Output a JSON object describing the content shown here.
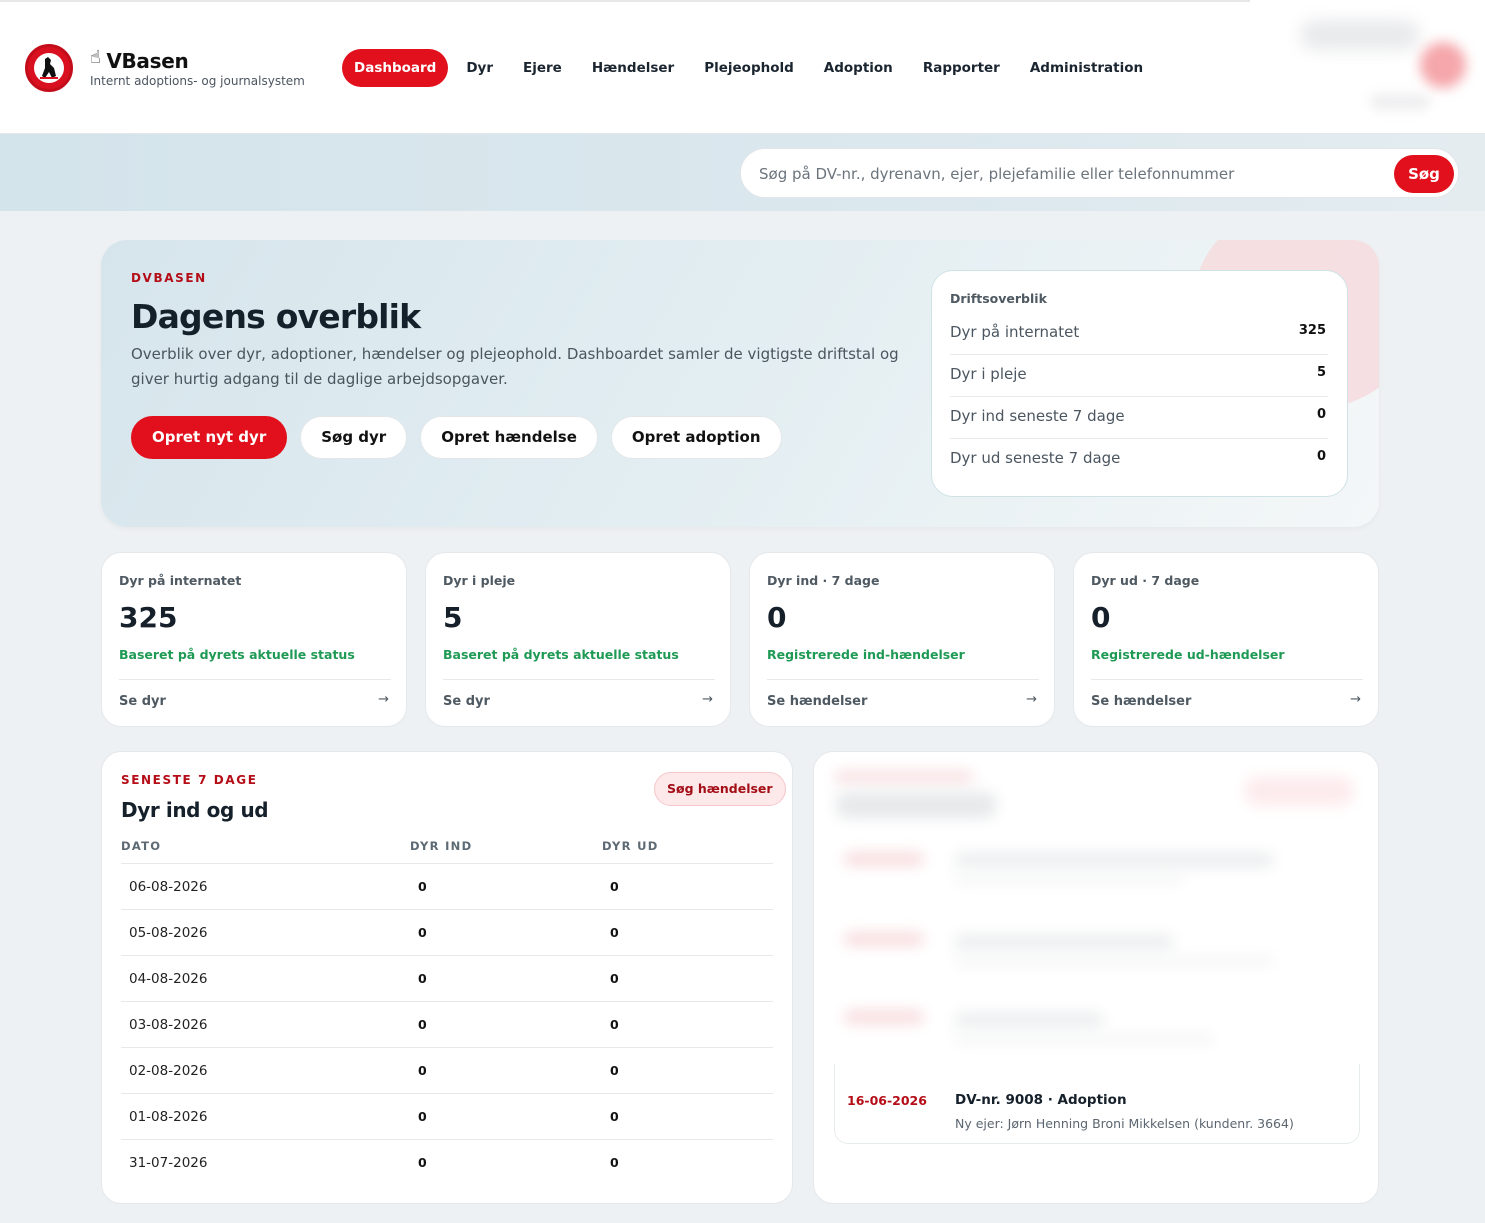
{
  "header": {
    "brand_name": "VBasen",
    "brand_cursor": "☝",
    "brand_sub": "Internt adoptions- og journalsystem",
    "nav": [
      {
        "label": "Dashboard",
        "active": true
      },
      {
        "label": "Dyr"
      },
      {
        "label": "Ejere"
      },
      {
        "label": "Hændelser"
      },
      {
        "label": "Plejeophold"
      },
      {
        "label": "Adoption"
      },
      {
        "label": "Rapporter"
      },
      {
        "label": "Administration"
      }
    ]
  },
  "search": {
    "placeholder": "Søg på DV-nr., dyrenavn, ejer, plejefamilie eller telefonnummer",
    "button_label": "Søg"
  },
  "hero": {
    "eyebrow": "DVBASEN",
    "title": "Dagens overblik",
    "description": "Overblik over dyr, adoptioner, hændelser og plejeophold. Dashboardet samler de vigtigste driftstal og giver hurtig adgang til de daglige arbejdsopgaver.",
    "buttons": [
      "Opret nyt dyr",
      "Søg dyr",
      "Opret hændelse",
      "Opret adoption"
    ]
  },
  "drift": {
    "title": "Driftsoverblik",
    "rows": [
      {
        "label": "Dyr på internatet",
        "value": "325"
      },
      {
        "label": "Dyr i pleje",
        "value": "5"
      },
      {
        "label": "Dyr ind seneste 7 dage",
        "value": "0"
      },
      {
        "label": "Dyr ud seneste 7 dage",
        "value": "0"
      }
    ]
  },
  "stats": [
    {
      "label": "Dyr på internatet",
      "value": "325",
      "note": "Baseret på dyrets aktuelle status",
      "link": "Se dyr",
      "arrow": "→"
    },
    {
      "label": "Dyr i pleje",
      "value": "5",
      "note": "Baseret på dyrets aktuelle status",
      "link": "Se dyr",
      "arrow": "→"
    },
    {
      "label": "Dyr ind · 7 dage",
      "value": "0",
      "note": "Registrerede ind-hændelser",
      "link": "Se hændelser",
      "arrow": "→"
    },
    {
      "label": "Dyr ud · 7 dage",
      "value": "0",
      "note": "Registrerede ud-hændelser",
      "link": "Se hændelser",
      "arrow": "→"
    }
  ],
  "table": {
    "eyebrow": "SENESTE 7 DAGE",
    "title": "Dyr ind og ud",
    "button_label": "Søg hændelser",
    "headers": [
      "DATO",
      "DYR IND",
      "DYR UD"
    ],
    "rows": [
      {
        "date": "06-08-2026",
        "in": "0",
        "out": "0"
      },
      {
        "date": "05-08-2026",
        "in": "0",
        "out": "0"
      },
      {
        "date": "04-08-2026",
        "in": "0",
        "out": "0"
      },
      {
        "date": "03-08-2026",
        "in": "0",
        "out": "0"
      },
      {
        "date": "02-08-2026",
        "in": "0",
        "out": "0"
      },
      {
        "date": "01-08-2026",
        "in": "0",
        "out": "0"
      },
      {
        "date": "31-07-2026",
        "in": "0",
        "out": "0"
      }
    ]
  },
  "events": {
    "visible_item": {
      "date": "16-06-2026",
      "title": "DV-nr. 9008 · Adoption",
      "description": "Ny ejer: Jørn Henning Broni Mikkelsen (kundenr. 3664)"
    }
  },
  "colors": {
    "accent": "#e1101c",
    "accent_dark": "#b50d17",
    "positive": "#1f9a55"
  }
}
